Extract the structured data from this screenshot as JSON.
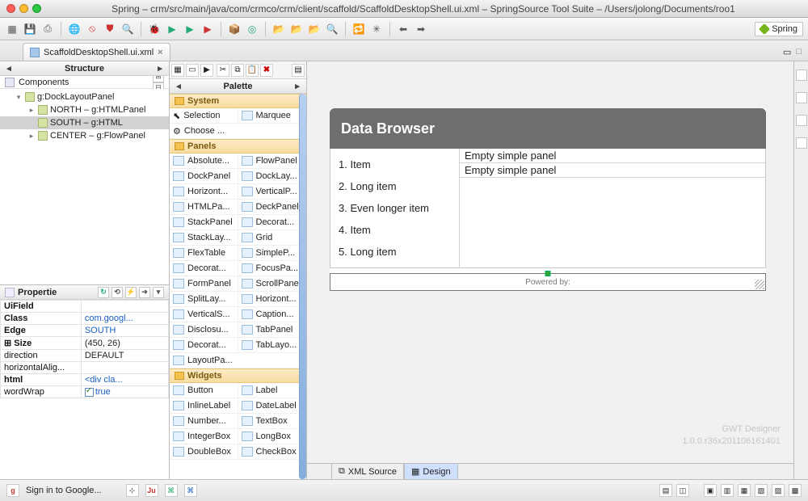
{
  "window": {
    "title": "Spring – crm/src/main/java/com/crmco/crm/client/scaffold/ScaffoldDesktopShell.ui.xml – SpringSource Tool Suite – /Users/jolong/Documents/roo1",
    "perspective": "Spring"
  },
  "editor": {
    "tab_label": "ScaffoldDesktopShell.ui.xml",
    "bottom_tabs": {
      "xml": "XML Source",
      "design": "Design"
    }
  },
  "structure": {
    "title": "Structure",
    "components_label": "Components",
    "tree": {
      "root": "g:DockLayoutPanel",
      "north": "NORTH – g:HTMLPanel",
      "south": "SOUTH – g:HTML",
      "center": "CENTER – g:FlowPanel"
    }
  },
  "properties": {
    "title": "Propertie",
    "rows": {
      "uifield": {
        "k": "UiField",
        "v": ""
      },
      "class": {
        "k": "Class",
        "v": "com.googl..."
      },
      "edge": {
        "k": "Edge",
        "v": "SOUTH"
      },
      "size": {
        "k": "Size",
        "v": "(450, 26)"
      },
      "direction": {
        "k": "direction",
        "v": "DEFAULT"
      },
      "halign": {
        "k": "horizontalAlig...",
        "v": ""
      },
      "html": {
        "k": "html",
        "v": "<div cla..."
      },
      "wordwrap": {
        "k": "wordWrap",
        "v": "true"
      }
    }
  },
  "palette": {
    "title": "Palette",
    "cats": {
      "system": "System",
      "panels": "Panels",
      "widgets": "Widgets"
    },
    "system": {
      "selection": "Selection",
      "marquee": "Marquee",
      "choose": "Choose ..."
    },
    "panels": [
      [
        "Absolute...",
        "FlowPanel"
      ],
      [
        "DockPanel",
        "DockLay..."
      ],
      [
        "Horizont...",
        "VerticalP..."
      ],
      [
        "HTMLPa...",
        "DeckPanel"
      ],
      [
        "StackPanel",
        "Decorat..."
      ],
      [
        "StackLay...",
        "Grid"
      ],
      [
        "FlexTable",
        "SimpleP..."
      ],
      [
        "Decorat...",
        "FocusPa..."
      ],
      [
        "FormPanel",
        "ScrollPanel"
      ],
      [
        "SplitLay...",
        "Horizont..."
      ],
      [
        "VerticalS...",
        "Caption..."
      ],
      [
        "Disclosu...",
        "TabPanel"
      ],
      [
        "Decorat...",
        "TabLayo..."
      ],
      [
        "LayoutPa...",
        ""
      ]
    ],
    "widgets": [
      [
        "Button",
        "Label"
      ],
      [
        "InlineLabel",
        "DateLabel"
      ],
      [
        "Number...",
        "TextBox"
      ],
      [
        "IntegerBox",
        "LongBox"
      ],
      [
        "DoubleBox",
        "CheckBox"
      ]
    ]
  },
  "mock": {
    "title": "Data Browser",
    "items": [
      "Item",
      "Long item",
      "Even longer item",
      "Item",
      "Long item"
    ],
    "empty": "Empty simple panel",
    "powered": "Powered by:"
  },
  "gwtdesigner": {
    "l1": "GWT Designer",
    "l2": "1.0.0.r36x201106161401"
  },
  "status": {
    "signin": "Sign in to Google..."
  }
}
